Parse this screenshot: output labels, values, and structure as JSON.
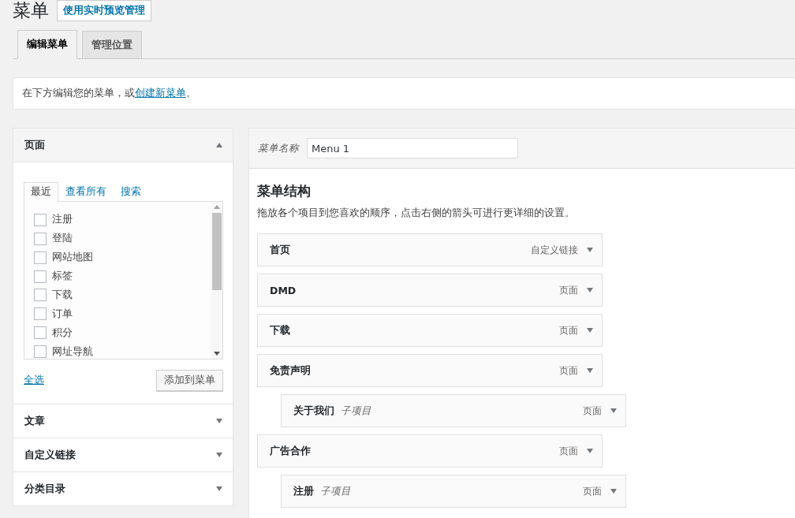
{
  "page": {
    "title": "菜单",
    "live_preview_button": "使用实时预览管理"
  },
  "tabs": [
    {
      "label": "编辑菜单",
      "selected": true
    },
    {
      "label": "管理位置",
      "selected": false
    }
  ],
  "notice": {
    "text": "在下方编辑您的菜单，或",
    "link": "创建新菜单",
    "end": "。"
  },
  "sidebar": {
    "sections": [
      {
        "title": "页面",
        "expanded": true,
        "tabs": [
          {
            "label": "最近",
            "selected": true
          },
          {
            "label": "查看所有",
            "selected": false
          },
          {
            "label": "搜索",
            "selected": false
          }
        ],
        "items": [
          {
            "label": "注册",
            "checked": false
          },
          {
            "label": "登陆",
            "checked": false
          },
          {
            "label": "网站地图",
            "checked": false
          },
          {
            "label": "标签",
            "checked": false
          },
          {
            "label": "下载",
            "checked": false
          },
          {
            "label": "订单",
            "checked": false
          },
          {
            "label": "积分",
            "checked": false
          },
          {
            "label": "网址导航",
            "checked": false
          }
        ],
        "select_all": "全选",
        "add_button": "添加到菜单"
      },
      {
        "title": "文章",
        "expanded": false
      },
      {
        "title": "自定义链接",
        "expanded": false
      },
      {
        "title": "分类目录",
        "expanded": false
      }
    ]
  },
  "editor": {
    "name_label": "菜单名称",
    "name_value": "Menu 1",
    "heading": "菜单结构",
    "instructions": "拖放各个项目到您喜欢的顺序，点击右侧的箭头可进行更详细的设置。",
    "items": [
      {
        "title": "首页",
        "type": "自定义链接"
      },
      {
        "title": "DMD",
        "type": "页面"
      },
      {
        "title": "下载",
        "type": "页面"
      },
      {
        "title": "免责声明",
        "type": "页面",
        "children": [
          {
            "title": "关于我们",
            "sublabel": "子项目",
            "type": "页面"
          }
        ]
      },
      {
        "title": "广告合作",
        "type": "页面",
        "children": [
          {
            "title": "注册",
            "sublabel": "子项目",
            "type": "页面"
          }
        ]
      }
    ]
  }
}
